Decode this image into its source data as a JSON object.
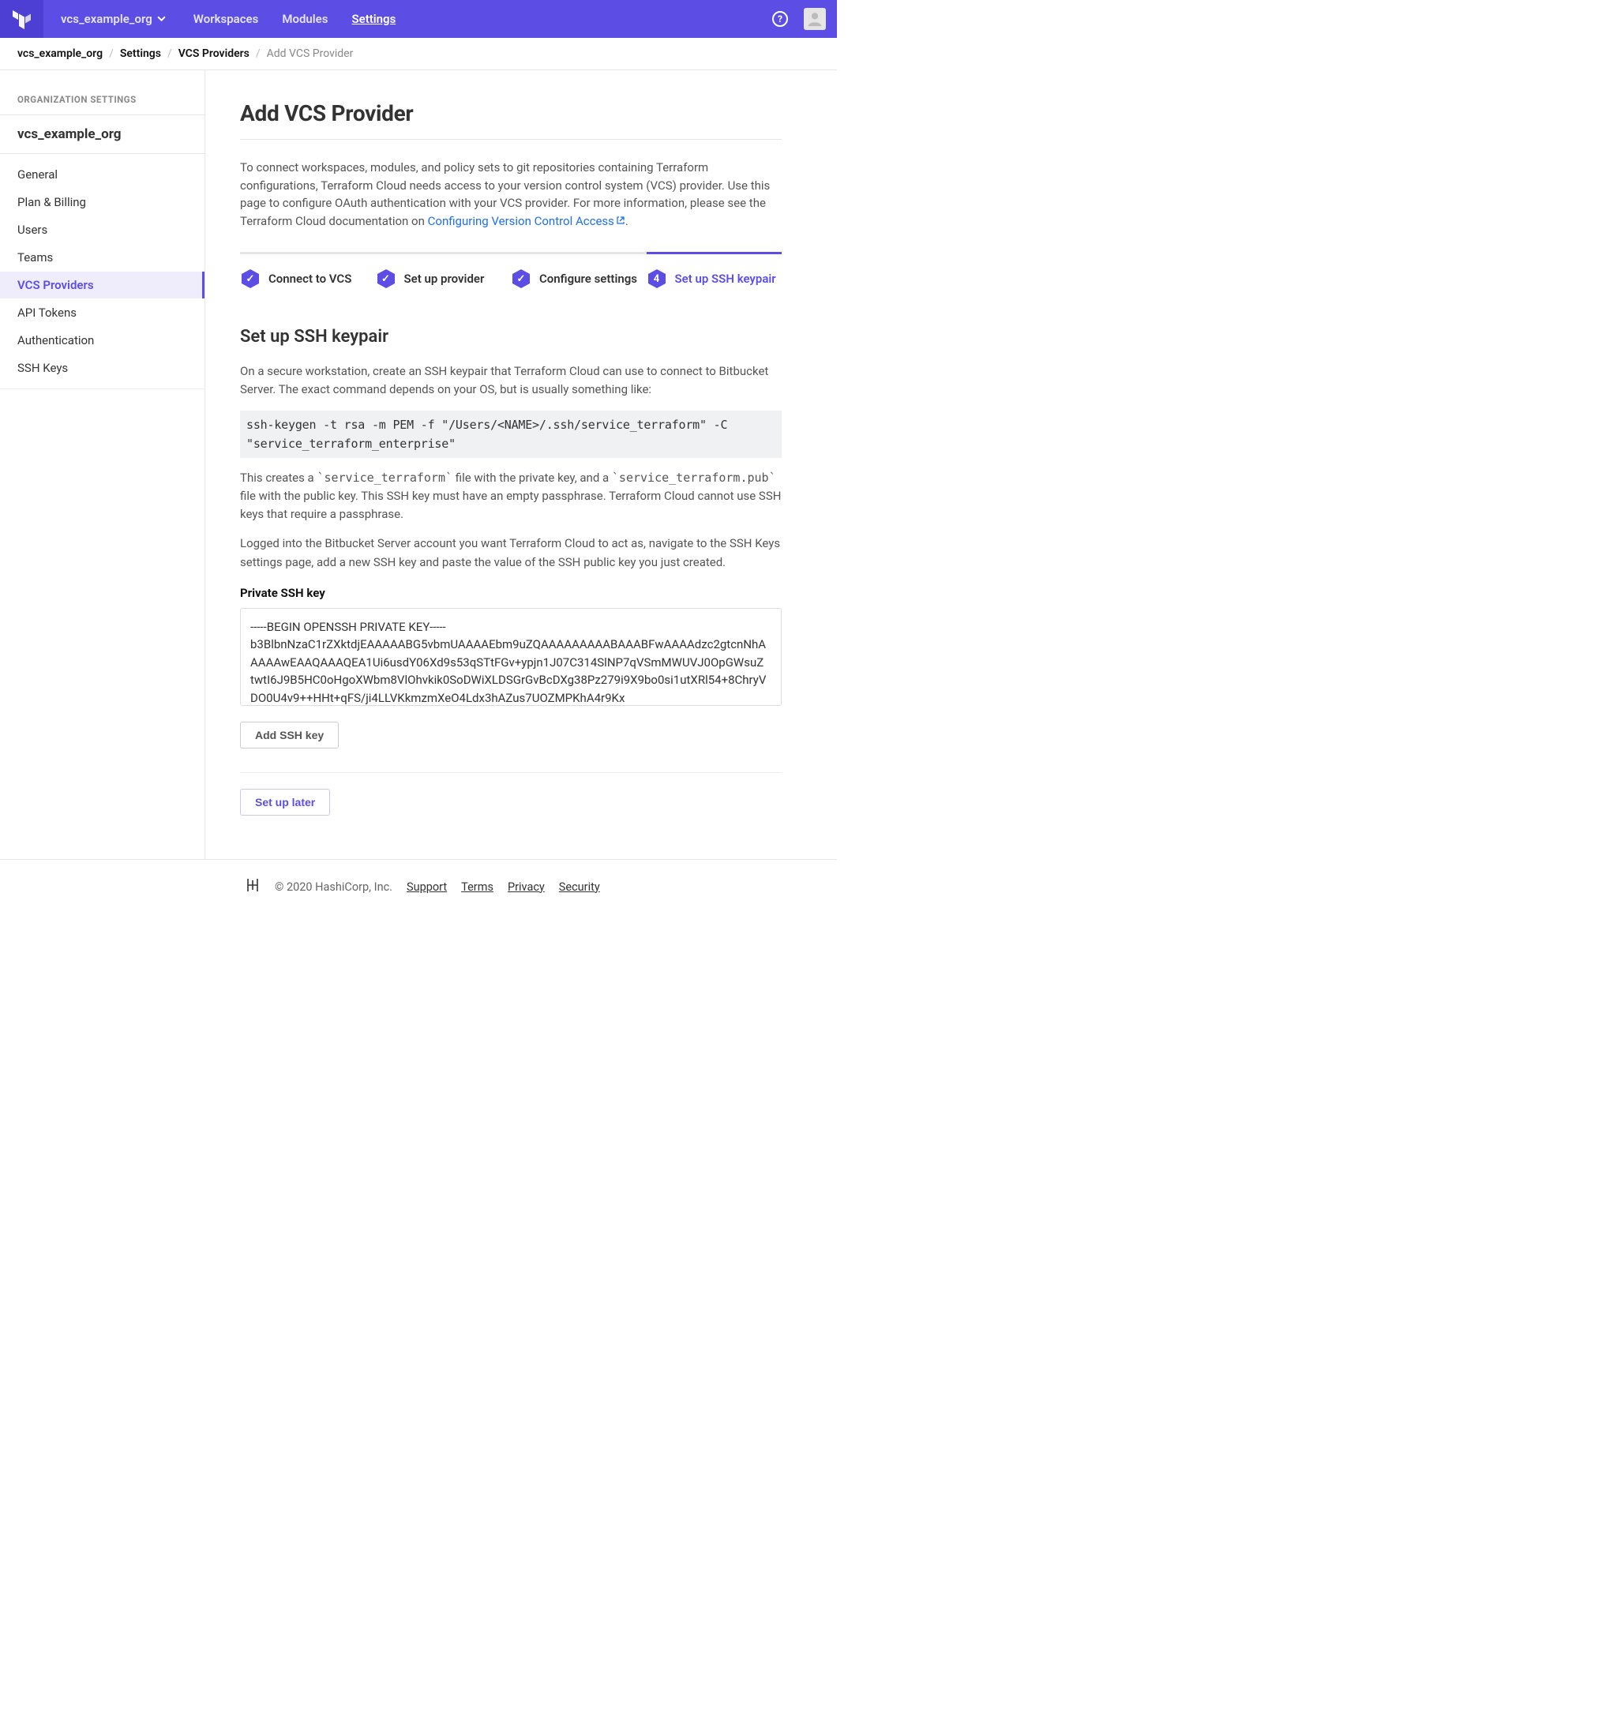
{
  "topnav": {
    "org_name": "vcs_example_org",
    "links": {
      "workspaces": "Workspaces",
      "modules": "Modules",
      "settings": "Settings"
    },
    "help_glyph": "?"
  },
  "breadcrumb": {
    "org": "vcs_example_org",
    "settings": "Settings",
    "vcs": "VCS Providers",
    "current": "Add VCS Provider"
  },
  "sidebar": {
    "section_title": "ORGANIZATION SETTINGS",
    "org_name": "vcs_example_org",
    "items": {
      "general": "General",
      "plan": "Plan & Billing",
      "users": "Users",
      "teams": "Teams",
      "vcs": "VCS Providers",
      "tokens": "API Tokens",
      "auth": "Authentication",
      "ssh": "SSH Keys"
    }
  },
  "page": {
    "title": "Add VCS Provider",
    "intro_text": "To connect workspaces, modules, and policy sets to git repositories containing Terraform configurations, Terraform Cloud needs access to your version control system (VCS) provider. Use this page to configure OAuth authentication with your VCS provider. For more information, please see the Terraform Cloud documentation on ",
    "intro_link": "Configuring Version Control Access",
    "intro_tail": "."
  },
  "steps": {
    "s1": {
      "label": "Connect to VCS",
      "mark": "✓"
    },
    "s2": {
      "label": "Set up provider",
      "mark": "✓"
    },
    "s3": {
      "label": "Configure settings",
      "mark": "✓"
    },
    "s4": {
      "label": "Set up SSH keypair",
      "mark": "4"
    }
  },
  "ssh": {
    "heading": "Set up SSH keypair",
    "p1": "On a secure workstation, create an SSH keypair that Terraform Cloud can use to connect to Bitbucket Server. The exact command depends on your OS, but is usually something like:",
    "cmd": "ssh-keygen -t rsa -m PEM -f \"/Users/<NAME>/.ssh/service_terraform\" -C \"service_terraform_enterprise\"",
    "p2a": "This creates a ",
    "p2code1": "`service_terraform`",
    "p2b": " file with the private key, and a ",
    "p2code2": "`service_terraform.pub`",
    "p2c": " file with the public key. This SSH key must have an empty passphrase. Terraform Cloud cannot use SSH keys that require a passphrase.",
    "p3": "Logged into the Bitbucket Server account you want Terraform Cloud to act as, navigate to the SSH Keys settings page, add a new SSH key and paste the value of the SSH public key you just created.",
    "label": "Private SSH key",
    "textarea_value": "-----BEGIN OPENSSH PRIVATE KEY-----\nb3BlbnNzaC1rZXktdjEAAAAABG5vbmUAAAAEbm9uZQAAAAAAAAABAAABFwAAAAdzc2gtcnNhAAAAAwEAAQAAAQEA1Ui6usdY06Xd9s53qSTtFGv+ypjn1J07C314SlNP7qVSmMWUVJ0OpGWsuZtwtI6J9B5HC0oHgoXWbm8VlOhvkik0SoDWiXLDSGrGvBcDXg38Pz279i9X9bo0si1utXRl54+8ChryVDO0U4v9++HHt+qFS/ji4LLVKkmzmXeO4Ldx3hAZus7UOZMPKhA4r9Kx",
    "add_btn": "Add SSH key",
    "later_btn": "Set up later"
  },
  "footer": {
    "copy": "© 2020 HashiCorp, Inc.",
    "support": "Support",
    "terms": "Terms",
    "privacy": "Privacy",
    "security": "Security"
  }
}
